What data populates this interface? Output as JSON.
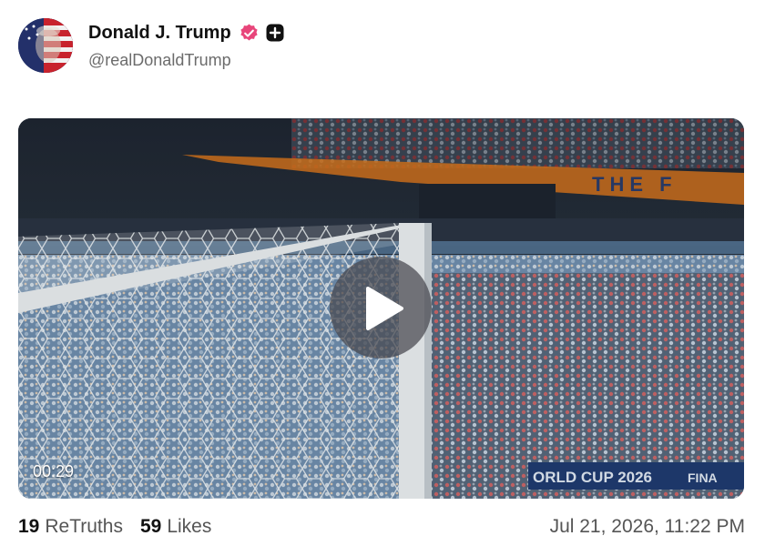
{
  "profile": {
    "display_name": "Donald J. Trump",
    "handle": "@realDonaldTrump",
    "avatar_icon": "flag-portrait-avatar",
    "verified_icon": "verified-badge-icon",
    "plus_icon": "plus-badge-icon"
  },
  "media": {
    "duration": "00:29",
    "play_icon": "play-icon",
    "signage_text": "THE F",
    "board_text": "ORLD CUP 2026",
    "board_text_suffix": "FINA"
  },
  "stats": {
    "retruths_count": "19",
    "retruths_label": "ReTruths",
    "likes_count": "59",
    "likes_label": "Likes"
  },
  "timestamp": "Jul 21, 2026, 11:22 PM",
  "colors": {
    "verified": "#e8457a",
    "signage_orange": "#d4731c",
    "crowd_blue": "#7da1c4"
  }
}
